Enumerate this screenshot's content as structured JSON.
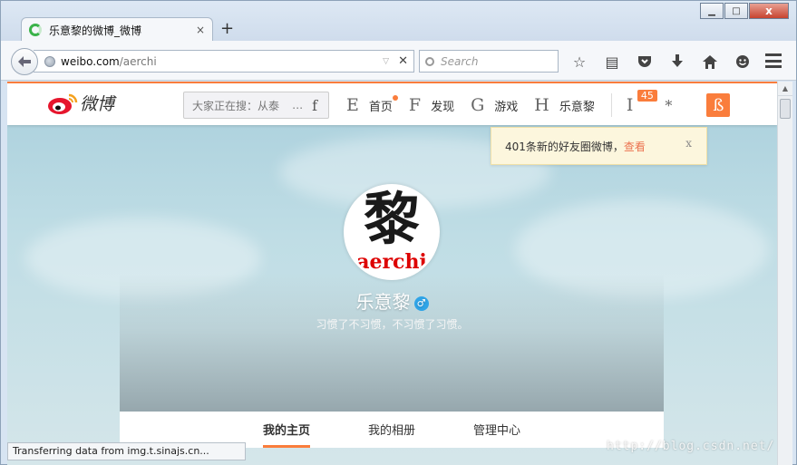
{
  "browser": {
    "tab_title": "乐意黎的微博_微博",
    "tab_close": "×",
    "new_tab": "+",
    "url_domain": "weibo.com",
    "url_path": "/aerchi",
    "search_placeholder": "Search",
    "status_text": "Transferring data from img.t.sinajs.cn...",
    "window_buttons": {
      "minimize": "▁",
      "maximize": "□",
      "close": "x"
    },
    "toolbar_icons": [
      "star-icon",
      "reading-list-icon",
      "pocket-icon",
      "download-icon",
      "home-icon",
      "hello-icon"
    ]
  },
  "weibo": {
    "logo_text": "微博",
    "search_placeholder": "大家正在搜：从泰",
    "search_ellipsis": "…",
    "search_btn_glyph": "f",
    "nav": [
      {
        "glyph": "E",
        "label": "首页"
      },
      {
        "glyph": "F",
        "label": "发现"
      },
      {
        "glyph": "G",
        "label": "游戏"
      },
      {
        "glyph": "H",
        "label": "乐意黎"
      }
    ],
    "msg_glyph": "I",
    "msg_count": "45",
    "settings_glyph": "*",
    "post_glyph": "ß",
    "notice": {
      "text": "401条新的好友圈微博，",
      "link": "查看",
      "close": "x"
    },
    "profile": {
      "avatar_char": "黎",
      "avatar_sub": "aerchi",
      "name": "乐意黎",
      "gender_icon": "♂",
      "bio": "习惯了不习惯，不习惯了习惯。"
    },
    "tabs": [
      "我的主页",
      "我的相册",
      "管理中心"
    ]
  },
  "watermark": "http://blog.csdn.net/",
  "colors": {
    "accent": "#fa7d3c",
    "notice_bg": "#fcf6dd",
    "link": "#eb7350"
  }
}
